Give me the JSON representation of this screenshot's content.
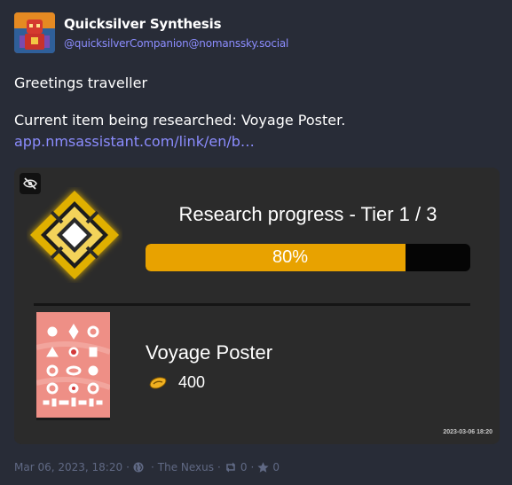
{
  "author": {
    "display_name": "Quicksilver Synthesis",
    "handle": "@quicksilverCompanion@nomanssky.social",
    "avatar_icon": "robot-avatar"
  },
  "status": {
    "greeting": "Greetings traveller",
    "research_line": "Current item being researched: Voyage Poster.",
    "link_text": "app.nmsassistant.com/link/en/b…"
  },
  "card": {
    "sensitive_toggle_icon": "eye-slash-icon",
    "progress_title": "Research progress - Tier 1 / 3",
    "progress_label": "80%",
    "progress_fraction": 0.8,
    "item_name": "Voyage Poster",
    "currency_icon": "quicksilver-icon",
    "item_cost": "400",
    "timestamp": "2023-03-06 18:20",
    "colors": {
      "progress_fill": "#e8a200",
      "emblem_gold": "#e0b000",
      "poster_bg": "#ee8f86"
    }
  },
  "meta": {
    "date": "Mar 06, 2023, 18:20",
    "visibility_icon": "globe-icon",
    "application": "The Nexus",
    "boost_icon": "retweet-icon",
    "boost_count": "0",
    "favourite_icon": "star-icon",
    "favourite_count": "0"
  }
}
